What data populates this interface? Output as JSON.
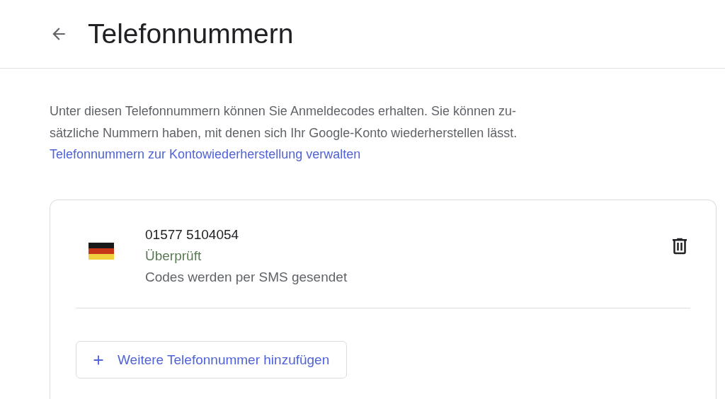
{
  "header": {
    "title": "Telefonnummern"
  },
  "description": {
    "lines": [
      "Unter diesen Telefonnummern können Sie Anmeldecodes erhalten. Sie können zu-",
      "sätzliche Nummern haben, mit denen sich Ihr Google-Konto wiederherstellen lässt."
    ]
  },
  "manage_link": "Telefonnummern zur Kontowiederherstellung verwalten",
  "phones": [
    {
      "number": "01577 5104054",
      "status": "Überprüft",
      "verified": true,
      "method": "Codes werden per SMS gesendet"
    }
  ],
  "add_button": {
    "label": "Weitere Telefonnummer hinzufügen"
  }
}
